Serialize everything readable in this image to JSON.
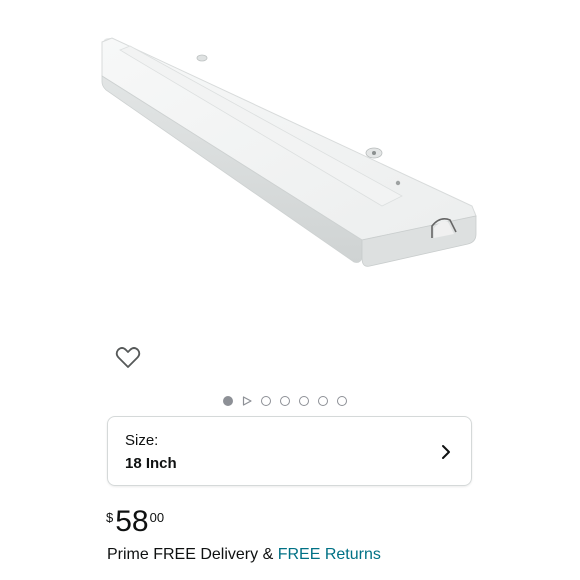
{
  "product": {
    "image_alt": "White under-cabinet LED light bar"
  },
  "icons": {
    "wishlist": "heart-outline-icon",
    "chevron": "chevron-right-icon"
  },
  "carousel": {
    "total_dots": 7,
    "active_index": 0,
    "video_index": 1
  },
  "size": {
    "label": "Size:",
    "value": "18 Inch"
  },
  "price": {
    "symbol": "$",
    "whole": "58",
    "fraction": "00"
  },
  "delivery": {
    "prefix": "Prime FREE Delivery & ",
    "returns_link": "FREE Returns"
  },
  "colors": {
    "link": "#007185",
    "text": "#0f1111",
    "border": "#d5d9d9",
    "dot": "#8d9096"
  }
}
